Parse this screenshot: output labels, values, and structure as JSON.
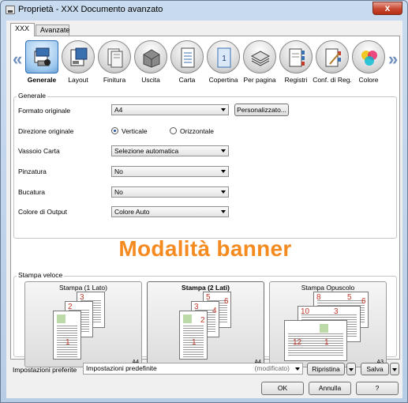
{
  "window": {
    "title": "Proprietà - XXX Documento avanzato",
    "close_label": "x"
  },
  "tabs": [
    {
      "label": "XXX"
    },
    {
      "label": "Avanzate"
    }
  ],
  "toolbar": {
    "prev_arrow": "«",
    "next_arrow": "»",
    "items": [
      {
        "label": "Generale",
        "icon": "general-settings-icon"
      },
      {
        "label": "Layout",
        "icon": "layout-icon"
      },
      {
        "label": "Finitura",
        "icon": "finishing-icon"
      },
      {
        "label": "Uscita",
        "icon": "output-icon"
      },
      {
        "label": "Carta",
        "icon": "paper-icon"
      },
      {
        "label": "Copertina",
        "icon": "cover-icon"
      },
      {
        "label": "Per pagina",
        "icon": "per-page-icon"
      },
      {
        "label": "Registri",
        "icon": "tabs-icon"
      },
      {
        "label": "Conf. di Reg.",
        "icon": "register-config-icon"
      },
      {
        "label": "Colore",
        "icon": "color-icon"
      }
    ]
  },
  "general": {
    "group_title": "Generale",
    "original_format": {
      "label": "Formato originale",
      "value": "A4",
      "custom_button": "Personalizzato..."
    },
    "orientation": {
      "label": "Direzione originale",
      "option_vertical": "Verticale",
      "option_horizontal": "Orizzontale",
      "selected": "Verticale"
    },
    "paper_tray": {
      "label": "Vassoio Carta",
      "value": "Selezione automatica"
    },
    "stapling": {
      "label": "Pinzatura",
      "value": "No"
    },
    "punching": {
      "label": "Bucatura",
      "value": "No"
    },
    "output_color": {
      "label": "Colore di Output",
      "value": "Colore Auto"
    }
  },
  "banner": {
    "text": "Modalità banner",
    "color": "#f58a1f"
  },
  "quick_print": {
    "group_title": "Stampa veloce",
    "presets": [
      {
        "title": "Stampa (1 Lato)",
        "paper": "A4",
        "pages": [
          "1",
          "2",
          "3"
        ]
      },
      {
        "title": "Stampa (2 Lati)",
        "paper": "A4",
        "pages": [
          "1",
          "2",
          "3",
          "4",
          "5",
          "6"
        ]
      },
      {
        "title": "Stampa Opuscolo",
        "paper": "A3",
        "pages": [
          "12",
          "1",
          "10",
          "3",
          "8",
          "5",
          "6"
        ]
      }
    ]
  },
  "footer": {
    "pref_label": "Impostazioni preferite",
    "pref_value": "Impostazioni predefinite",
    "pref_modified": "(modificato)",
    "restore_button": "Ripristina",
    "save_button": "Salva",
    "ok_button": "OK",
    "cancel_button": "Annulla",
    "help_button": "?"
  }
}
